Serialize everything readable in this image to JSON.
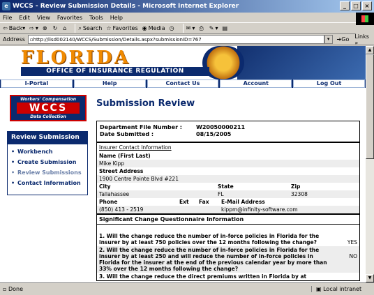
{
  "window": {
    "title": "WCCS - Review Submission Details - Microsoft Internet Explorer"
  },
  "menu": [
    "File",
    "Edit",
    "View",
    "Favorites",
    "Tools",
    "Help"
  ],
  "toolbar": {
    "back": "Back",
    "search": "Search",
    "favorites": "Favorites",
    "media": "Media"
  },
  "address": {
    "label": "Address",
    "url": "http://lisd002140/WCCS/Submission/Details.aspx?submissionID=767",
    "go": "Go",
    "links": "Links"
  },
  "banner": {
    "florida": "FLORIDA",
    "office": "OFFICE OF INSURANCE REGULATION"
  },
  "nav": [
    "I-Portal",
    "Help",
    "Contact Us",
    "Account",
    "Log Out"
  ],
  "logo": {
    "top": "Workers' Compensation",
    "main": "WCCS",
    "bottom": "Data Collection"
  },
  "leftnav": {
    "header": "Review Submission",
    "items": [
      "Workbench",
      "Create Submission",
      "Review Submissions",
      "Contact Information"
    ]
  },
  "page": {
    "title": "Submission Review"
  },
  "summary": {
    "dept_label": "Department File Number :",
    "dept_value": "W20050000211",
    "date_label": "Date Submitted :",
    "date_value": "08/15/2005"
  },
  "contact": {
    "section": "Insurer Contact Information",
    "name_label": "Name (First Last)",
    "name": "Mike Kipp",
    "street_label": "Street Address",
    "street": "1900 Centre Pointe Blvd #221",
    "city_label": "City",
    "state_label": "State",
    "zip_label": "Zip",
    "city": "Tallahassee",
    "state": "FL",
    "zip": "32308",
    "phone_label": "Phone",
    "ext_label": "Ext",
    "fax_label": "Fax",
    "email_label": "E-Mail Address",
    "phone": "(850) 413 - 2519",
    "email": "kippm@infinity-software.com"
  },
  "questionnaire": {
    "section": "Significant Change Questionnaire Information",
    "questions": [
      {
        "text": "1. Will the change reduce the number of in-force policies in Florida for the insurer by at least 750 policies over the 12 months following the change?",
        "answer": "YES"
      },
      {
        "text": "2. Will the change reduce the number of in-force policies in Florida for the insurer by at least 250 and will reduce the number of in-force policies in Florida for the insurer at the end of the previous calendar year by more than 33% over the 12 months following the change?",
        "answer": "NO"
      },
      {
        "text": "3. Will the change reduce the direct premiums written in Florida by at",
        "answer": ""
      }
    ]
  },
  "status": {
    "left": "Done",
    "zone": "Local intranet"
  }
}
